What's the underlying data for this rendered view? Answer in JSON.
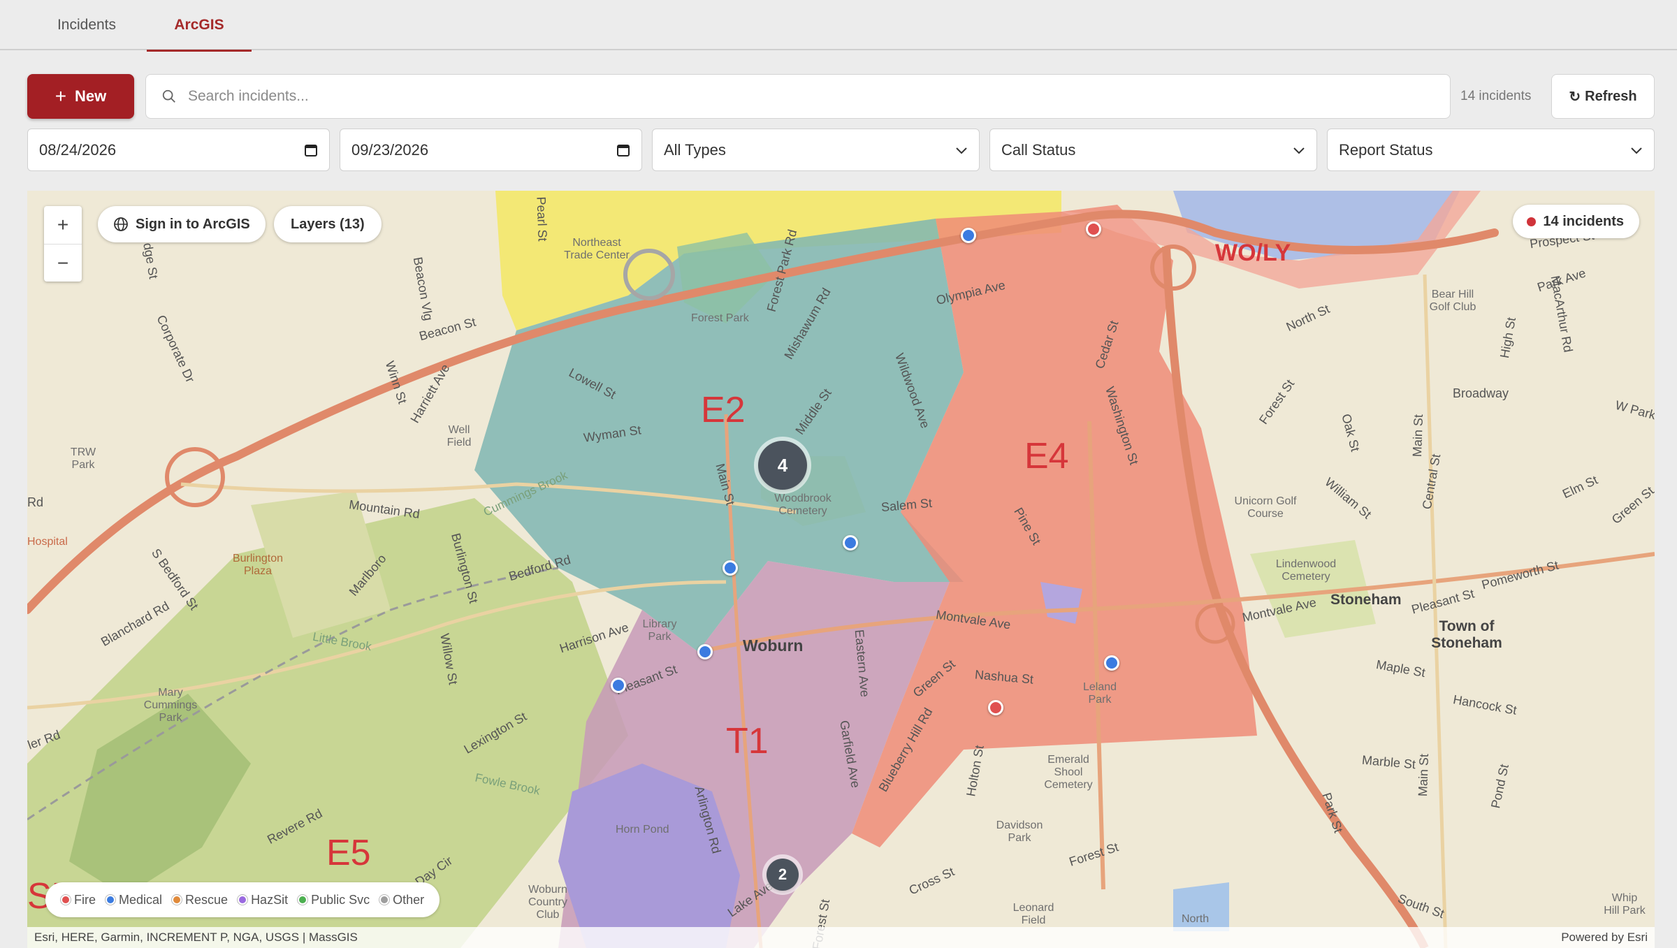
{
  "tabs": [
    {
      "label": "Incidents",
      "active": false
    },
    {
      "label": "ArcGIS",
      "active": true
    }
  ],
  "toolbar": {
    "new_label": "New",
    "search_placeholder": "Search incidents...",
    "incident_count": "14 incidents",
    "refresh_label": "Refresh"
  },
  "filters": {
    "date_from": "08/24/2026",
    "date_to": "09/23/2026",
    "type": "All Types",
    "call_status": "Call Status",
    "report_status": "Report Status"
  },
  "map": {
    "sign_in_label": "Sign in to ArcGIS",
    "layers_label": "Layers (13)",
    "zoom_in": "+",
    "zoom_out": "−",
    "incident_badge": "14 incidents",
    "attribution": "Esri, HERE, Garmin, INCREMENT P, NGA, USGS | MassGIS",
    "powered_by": "Powered by Esri",
    "zones": [
      "E2",
      "E4",
      "T1",
      "E5",
      "WO/LY",
      "SE"
    ],
    "places": {
      "woburn": "Woburn",
      "stoneham": "Stoneham",
      "town_of_stoneham": "Town of Stoneham"
    },
    "clusters": [
      {
        "count": "4"
      },
      {
        "count": "2"
      }
    ],
    "legend": [
      {
        "label": "Fire",
        "color": "#e05050"
      },
      {
        "label": "Medical",
        "color": "#3b7be0"
      },
      {
        "label": "Rescue",
        "color": "#e08a3b"
      },
      {
        "label": "HazSit",
        "color": "#9a6ae0"
      },
      {
        "label": "Public Svc",
        "color": "#4caf50"
      },
      {
        "label": "Other",
        "color": "#9e9e9e"
      }
    ],
    "labels": {
      "northeast_trade_center": "Northeast Trade Center",
      "forest_park": "Forest Park",
      "well_field": "Well Field",
      "trw_park": "TRW Park",
      "burlington_plaza": "Burlington Plaza",
      "mary_cummings_park": "Mary Cummings Park",
      "library_park": "Library Park",
      "woodbrook_cemetery": "Woodbrook Cemetery",
      "horn_pond": "Horn Pond",
      "woburn_country_club": "Woburn Country Club",
      "leland_park": "Leland Park",
      "emerald_shoal_cemetery": "Emerald Shool Cemetery",
      "davidson_park": "Davidson Park",
      "leonard_field": "Leonard Field",
      "unicorn_golf_course": "Unicorn Golf Course",
      "lindenwood_cemetery": "Lindenwood Cemetery",
      "bear_hill_golf_club": "Bear Hill Golf Club",
      "north": "North",
      "hospital": "Hospital",
      "beacon_st": "Beacon St",
      "lowell_st": "Lowell St",
      "wyman_st": "Wyman St",
      "salem_st": "Salem St",
      "olympia_ave": "Olympia Ave",
      "montvale_ave": "Montvale Ave",
      "montvale_ave_2": "Montvale Ave",
      "nashua_st": "Nashua St",
      "mountain_rd": "Mountain Rd",
      "bedford_rd": "Bedford Rd",
      "lexington_st": "Lexington St",
      "pleasant_st": "Pleasant St",
      "harrison_ave": "Harrison Ave",
      "main_st": "Main St",
      "washington_st": "Washington St",
      "cedar_st": "Cedar St",
      "forest_st": "Forest St",
      "broadway": "Broadway",
      "maple_st": "Maple St",
      "hancock_st": "Hancock St",
      "marble_st": "Marble St",
      "elm_st": "Elm St",
      "pomeworth_st": "Pomeworth St",
      "prospect_st": "Prospect St",
      "park_ave": "Park Ave",
      "north_st": "North St",
      "cross_st": "Cross St",
      "forest_st_2": "Forest St",
      "revere_rd": "Revere Rd",
      "green_st": "Green St",
      "pine_st": "Pine St",
      "blueberry_hill_rd": "Blueberry Hill Rd",
      "garfield_ave": "Garfield Ave",
      "eastern_ave": "Eastern Ave",
      "arlington_rd": "Arlington Rd",
      "wildwood_ave": "Wildwood Ave",
      "middle_st": "Middle St",
      "mishawum_rd": "Mishawum Rd",
      "forest_park_rd": "Forest Park Rd",
      "corporate_dr": "Corporate Dr",
      "harriett_ave": "Harriett Ave",
      "winn_st": "Winn St",
      "burlington_st": "Burlington St",
      "willow_st": "Willow St",
      "marlboro_st": "Marlboro",
      "blanchard_rd": "Blanchard Rd",
      "s_bedford_st": "S Bedford St",
      "little_brook": "Little Brook",
      "fowle_brook": "Fowle Brook",
      "cummings_brook": "Cummings Brook",
      "lake_ave": "Lake Ave",
      "day_cir": "Day Cir",
      "holton_st": "Holton St",
      "park_st": "Park St",
      "pond_st": "Pond St",
      "south_st": "South St",
      "central_st": "Central St",
      "william_st": "William St",
      "oak_st": "Oak St",
      "high_st": "High St",
      "macarthur_rd": "MacArthur Rd",
      "green_st_2": "Green St",
      "w_park": "W Park",
      "pleasant_st_2": "Pleasant St",
      "main_st_2": "Main St",
      "main_st_3": "Main St",
      "forest_st_3": "Forest St",
      "whip_hill_park": "Whip Hill Park",
      "pearl_st": "Pearl St",
      "beacon_vlg": "Beacon Vlg",
      "lodge_st": "dge St",
      "rd": "Rd",
      "ler_rd": "ler Rd"
    }
  }
}
